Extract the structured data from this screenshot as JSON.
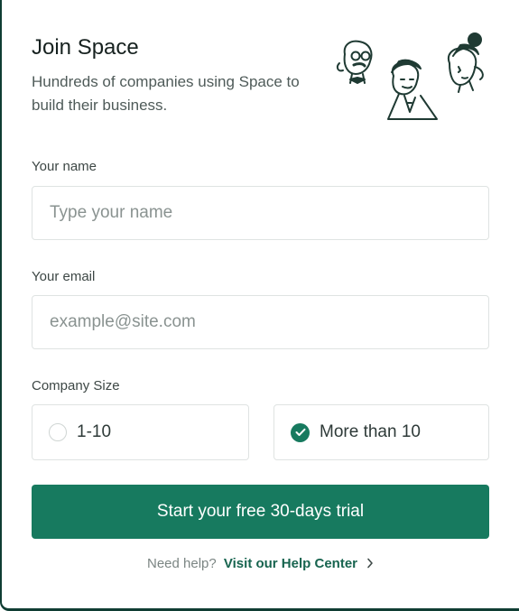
{
  "header": {
    "title": "Join Space",
    "subtitle": "Hundreds of companies using Space to build their business.",
    "illustration_icon": "three-people-sketch-icon"
  },
  "form": {
    "name": {
      "label": "Your name",
      "placeholder": "Type your name",
      "value": ""
    },
    "email": {
      "label": "Your email",
      "placeholder": "example@site.com",
      "value": ""
    },
    "company_size": {
      "label": "Company Size",
      "options": [
        {
          "label": "1-10",
          "selected": false
        },
        {
          "label": "More than 10",
          "selected": true
        }
      ]
    },
    "submit_label": "Start your free 30-days trial"
  },
  "help": {
    "prefix": "Need help?",
    "link_label": "Visit our Help Center",
    "link_icon": "chevron-right-icon"
  },
  "colors": {
    "accent": "#177a5f",
    "border": "#dfe3e2",
    "title": "#16211f"
  }
}
